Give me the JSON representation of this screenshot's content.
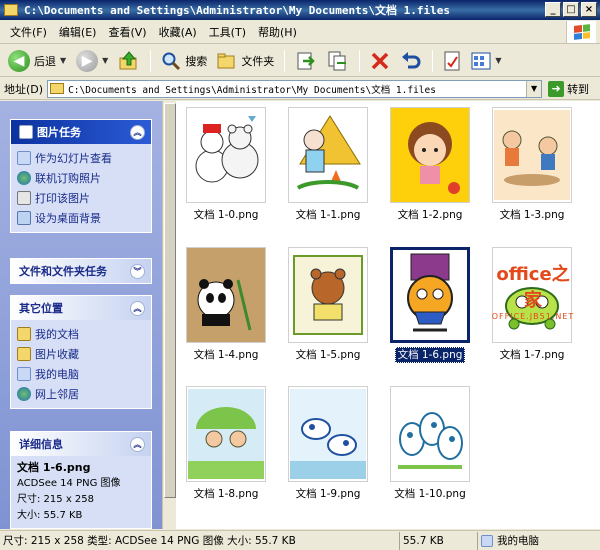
{
  "window": {
    "title": "C:\\Documents and Settings\\Administrator\\My Documents\\文档 1.files",
    "minimize": "_",
    "maximize": "□",
    "close": "×"
  },
  "menu": [
    "文件(F)",
    "编辑(E)",
    "查看(V)",
    "收藏(A)",
    "工具(T)",
    "帮助(H)"
  ],
  "toolbar": {
    "back": "后退",
    "search": "搜索",
    "folders": "文件夹"
  },
  "address": {
    "label": "地址(D)",
    "path": "C:\\Documents and Settings\\Administrator\\My Documents\\文档 1.files",
    "go": "转到"
  },
  "left": {
    "picture_tasks": {
      "title": "图片任务",
      "items": [
        "作为幻灯片查看",
        "联机订购照片",
        "打印该图片",
        "设为桌面背景"
      ]
    },
    "file_tasks": {
      "title": "文件和文件夹任务"
    },
    "other_places": {
      "title": "其它位置",
      "items": [
        "我的文档",
        "图片收藏",
        "我的电脑",
        "网上邻居"
      ]
    },
    "details": {
      "title": "详细信息",
      "name": "文档 1-6.png",
      "type": "ACDSee 14 PNG 图像",
      "size_dim": "尺寸: 215 x 258",
      "size_kb": "大小: 55.7 KB"
    }
  },
  "files": [
    {
      "name": "文档 1-0.png",
      "icon": "snowman-bears"
    },
    {
      "name": "文档 1-1.png",
      "icon": "mouse-campfire"
    },
    {
      "name": "文档 1-2.png",
      "icon": "cartoon-girl"
    },
    {
      "name": "文档 1-3.png",
      "icon": "kids-picnic"
    },
    {
      "name": "文档 1-4.png",
      "icon": "panda"
    },
    {
      "name": "文档 1-5.png",
      "icon": "bear-reading"
    },
    {
      "name": "文档 1-6.png",
      "icon": "cat-robot",
      "selected": true
    },
    {
      "name": "文档 1-7.png",
      "icon": "green-bug"
    },
    {
      "name": "文档 1-8.png",
      "icon": "kids-umbrella"
    },
    {
      "name": "文档 1-9.png",
      "icon": "cows-field"
    },
    {
      "name": "文档 1-10.png",
      "icon": "cows-group"
    }
  ],
  "watermark": {
    "line1": "office之家",
    "line2": "OFFICE.JB51.NET"
  },
  "status": {
    "info": "尺寸: 215 x 258 类型: ACDSee 14 PNG 图像 大小: 55.7 KB",
    "size": "55.7 KB",
    "zone": "我的电脑"
  }
}
